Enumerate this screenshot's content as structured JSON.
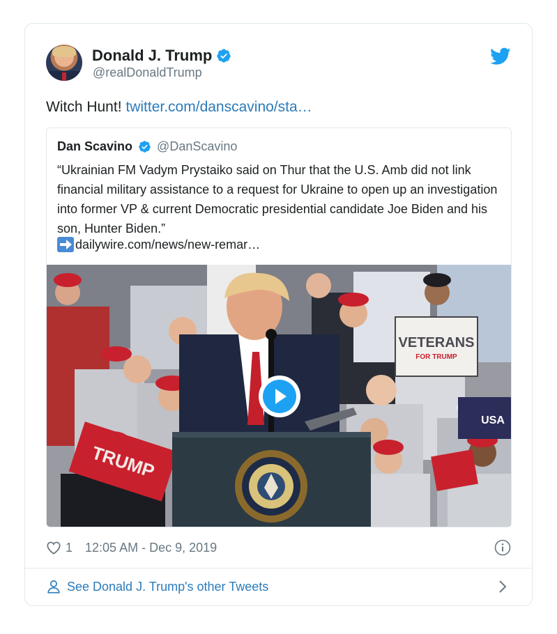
{
  "author": {
    "display_name": "Donald J. Trump",
    "handle": "@realDonaldTrump"
  },
  "tweet": {
    "text": "Witch Hunt!",
    "link": "twitter.com/danscavino/sta…"
  },
  "quoted_tweet": {
    "display_name": "Dan Scavino",
    "handle": "@DanScavino",
    "text": "“Ukrainian FM Vadym Prystaiko said on Thur that the U.S. Amb did not link financial military assistance to a request for Ukraine to open up an investigation into former VP & current Democratic presidential candidate Joe Biden and his son, Hunter Biden.”",
    "link": "dailywire.com/news/new-remar…"
  },
  "media": {
    "signs": {
      "veterans_title": "VETERANS",
      "veterans_sub": "FOR TRUMP",
      "trump": "TRUMP",
      "usa": "USA"
    }
  },
  "meta": {
    "likes": "1",
    "timestamp": "12:05 AM - Dec 9, 2019"
  },
  "footer": {
    "label": "See Donald J. Trump's other Tweets"
  },
  "colors": {
    "link": "#2b7bb9",
    "twitter_blue": "#1da1f2",
    "secondary_text": "#697882",
    "border": "#e1e8ed"
  },
  "icons": [
    "verified-icon",
    "twitter-bird-icon",
    "play-icon",
    "heart-icon",
    "info-icon",
    "person-icon",
    "chevron-right-icon",
    "arrow-right-emoji-icon"
  ]
}
